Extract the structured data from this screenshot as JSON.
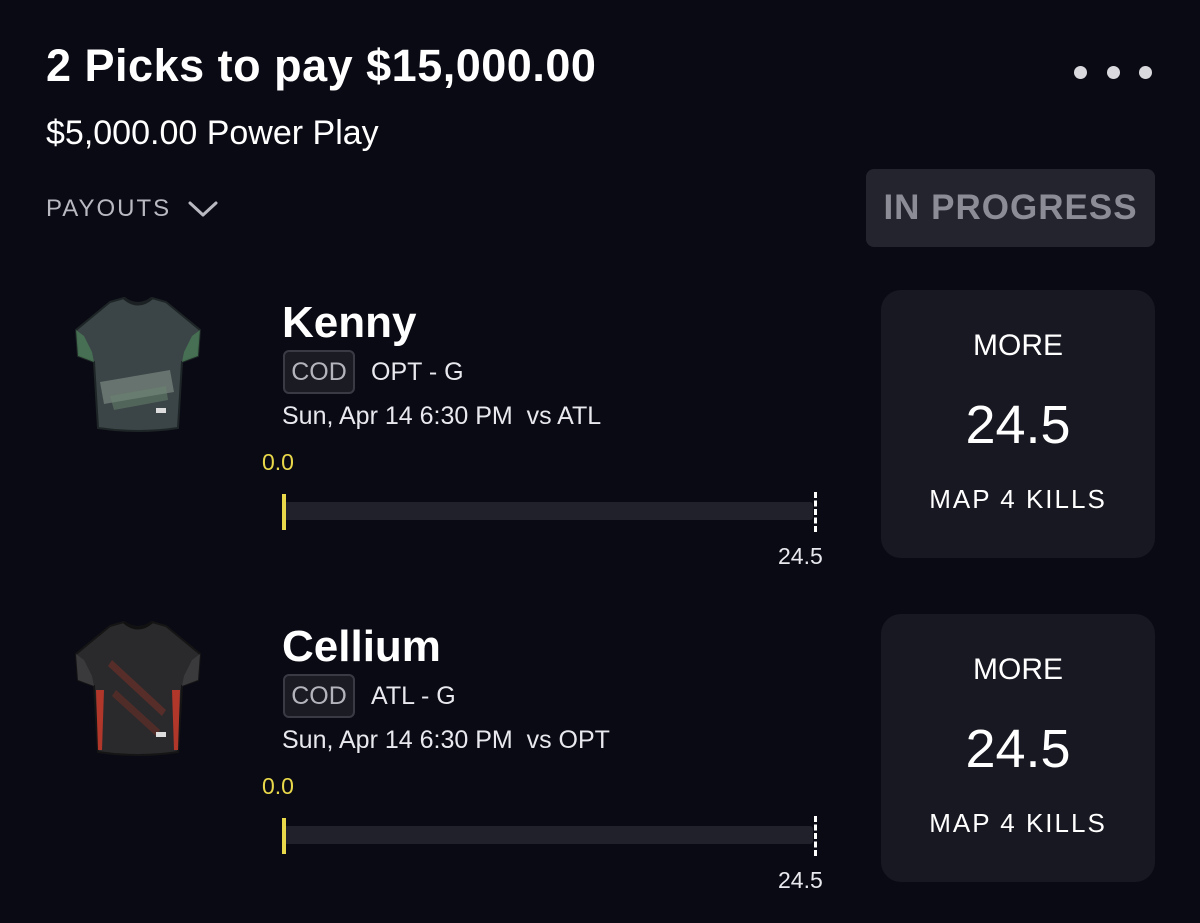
{
  "header": {
    "title": "2 Picks to pay $15,000.00",
    "subtitle": "$5,000.00 Power Play",
    "menu_icon": "more-horizontal-icon"
  },
  "payouts": {
    "label": "PAYOUTS",
    "icon": "chevron-down-icon"
  },
  "status": {
    "label": "IN PROGRESS"
  },
  "picks": [
    {
      "player": "Kenny",
      "league": "COD",
      "team_position": "OPT - G",
      "game_time": "Sun, Apr 14 6:30 PM",
      "opponent": "vs ATL",
      "current": "0.0",
      "target": "24.5",
      "progress_fraction": 0,
      "direction": "MORE",
      "line": "24.5",
      "stat": "MAP 4 KILLS",
      "jersey_colors": {
        "base": "#3b4446",
        "trim": "#4a7a56",
        "accent": "#8d9a8f"
      }
    },
    {
      "player": "Cellium",
      "league": "COD",
      "team_position": "ATL - G",
      "game_time": "Sun, Apr 14 6:30 PM",
      "opponent": "vs OPT",
      "current": "0.0",
      "target": "24.5",
      "progress_fraction": 0,
      "direction": "MORE",
      "line": "24.5",
      "stat": "MAP 4 KILLS",
      "jersey_colors": {
        "base": "#2a2a2c",
        "trim": "#c0392b",
        "accent": "#6b2f28"
      }
    }
  ],
  "colors": {
    "background": "#0a0a14",
    "progress": "#e9d84a",
    "card": "#181822",
    "badge": "#24242e"
  }
}
